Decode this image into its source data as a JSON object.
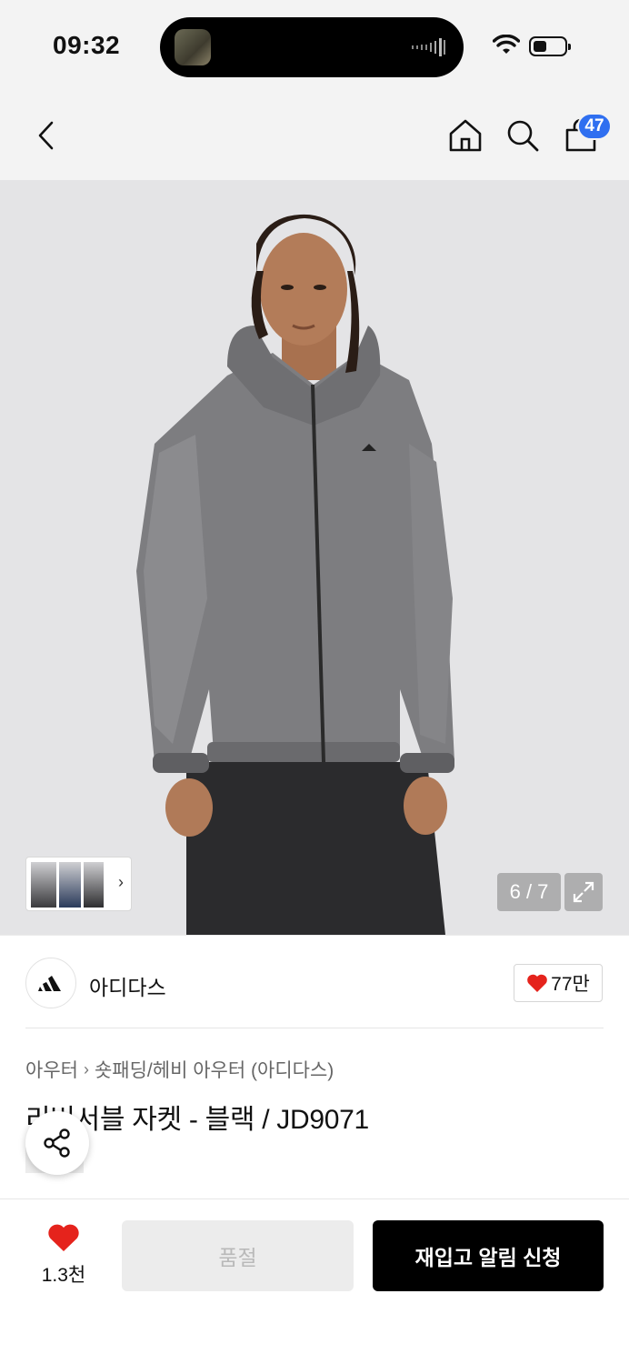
{
  "status_bar": {
    "time": "09:32"
  },
  "header": {
    "cart_count": "47"
  },
  "gallery": {
    "page_indicator": "6 / 7"
  },
  "brand": {
    "name": "아디다스",
    "like_count": "77만"
  },
  "product": {
    "category": "아우터",
    "subcategory": "숏패딩/헤비 아우터 (아디다스)",
    "title": "리버서블 자켓 - 블랙 / JD9071"
  },
  "bottom_bar": {
    "wish_count": "1.3천",
    "soldout_label": "품절",
    "restock_label": "재입고 알림 신청"
  },
  "colors": {
    "accent_blue": "#2f6ff0",
    "heart_red": "#e5231c"
  },
  "icons": [
    "back-icon",
    "home-icon",
    "search-icon",
    "shopping-bag-icon",
    "chevron-right-icon",
    "expand-icon",
    "adidas-logo-icon",
    "heart-icon",
    "share-icon",
    "wifi-icon",
    "battery-icon"
  ]
}
